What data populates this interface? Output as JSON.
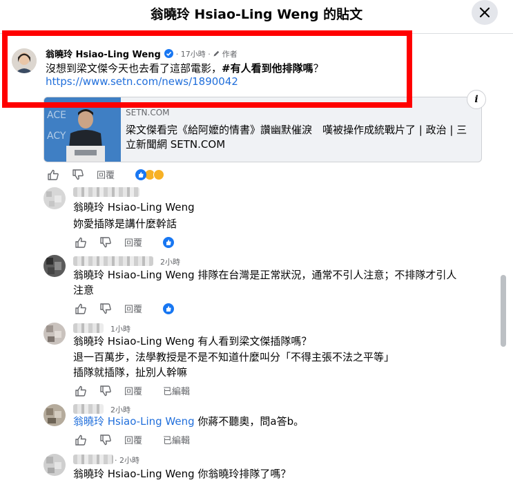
{
  "header": {
    "title": "翁曉玲 Hsiao-Ling Weng 的貼文",
    "close_icon": "close-icon"
  },
  "post": {
    "author": "翁曉玲 Hsiao-Ling Weng",
    "time": "· 17小時 ·",
    "author_badge": "作者",
    "text_plain": "沒想到梁文傑今天也去看了這部電影，",
    "text_bold": "#有人看到他排隊嗎",
    "text_end": "？",
    "link": "https://www.setn.com/news/1890042",
    "card": {
      "domain": "SETN.COM",
      "title": "梁文傑看完《給阿嬤的情書》讚幽默催淚　嘆被操作成統戰片了 | 政治 | 三立新聞網 SETN.COM",
      "info_label": "i"
    },
    "actions": {
      "reply": "回覆"
    }
  },
  "comments": [
    {
      "time": "",
      "lines": [
        "翁曉玲 Hsiao-Ling Weng",
        "妳愛插隊是講什麼幹話"
      ],
      "reply": "回覆",
      "edited": ""
    },
    {
      "time": "2小時",
      "lines": [
        "翁曉玲 Hsiao-Ling Weng 排隊在台灣是正常狀況，通常不引人注意；不排隊才引人",
        "注意"
      ],
      "reply": "回覆",
      "edited": ""
    },
    {
      "time": "1小時",
      "lines": [
        "翁曉玲 Hsiao-Ling Weng 有人看到梁文傑插隊嗎？",
        "退一百萬步，法學教授是不是不知道什麼叫分「不得主張不法之平等」",
        "插隊就插隊，扯別人幹嘛"
      ],
      "reply": "回覆",
      "edited": "已編輯"
    },
    {
      "time": "2小時",
      "tag": "翁曉玲 Hsiao-Ling Weng",
      "lines": [
        " 你蔣不聽奧，問a答b。"
      ],
      "reply": "回覆",
      "edited": "已編輯"
    },
    {
      "time": "2小時",
      "lines": [
        "翁曉玲 Hsiao-Ling Weng 你翁曉玲排隊了嗎？"
      ],
      "reply": "",
      "edited": ""
    }
  ],
  "colors": {
    "accent": "#1877f2",
    "link": "#216fdb",
    "highlight": "#ff0000",
    "muted": "#65676b"
  }
}
